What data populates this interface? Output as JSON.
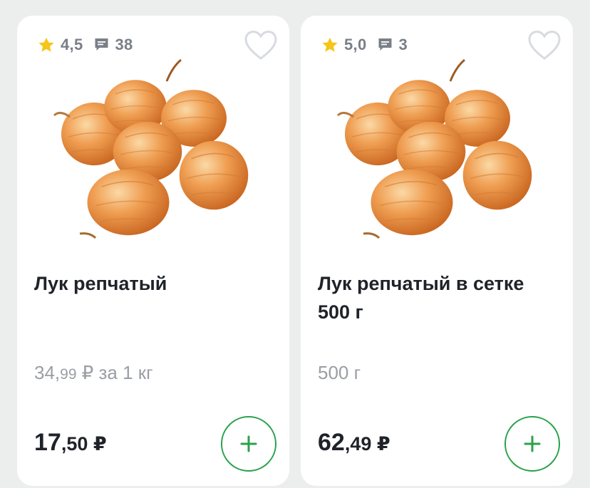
{
  "products": [
    {
      "rating": "4,5",
      "reviews": "38",
      "title": "Лук репчатый",
      "unit_int": "34,",
      "unit_frac": "99",
      "unit_rest": " ₽ за 1 кг",
      "price_int": "17",
      "price_frac": ",50",
      "price_currency": " ₽"
    },
    {
      "rating": "5,0",
      "reviews": "3",
      "title": "Лук репчатый в сетке 500 г",
      "unit_int": "500 г",
      "unit_frac": "",
      "unit_rest": "",
      "price_int": "62",
      "price_frac": ",49",
      "price_currency": " ₽"
    }
  ],
  "icons": {
    "rating": "star-icon",
    "reviews": "comment-icon",
    "favorite": "heart-outline-icon",
    "add": "plus-icon"
  },
  "colors": {
    "star": "#f5c518",
    "accent_green": "#2aa24b",
    "muted_text": "#9a9ea4",
    "onion": "#e9893a"
  }
}
